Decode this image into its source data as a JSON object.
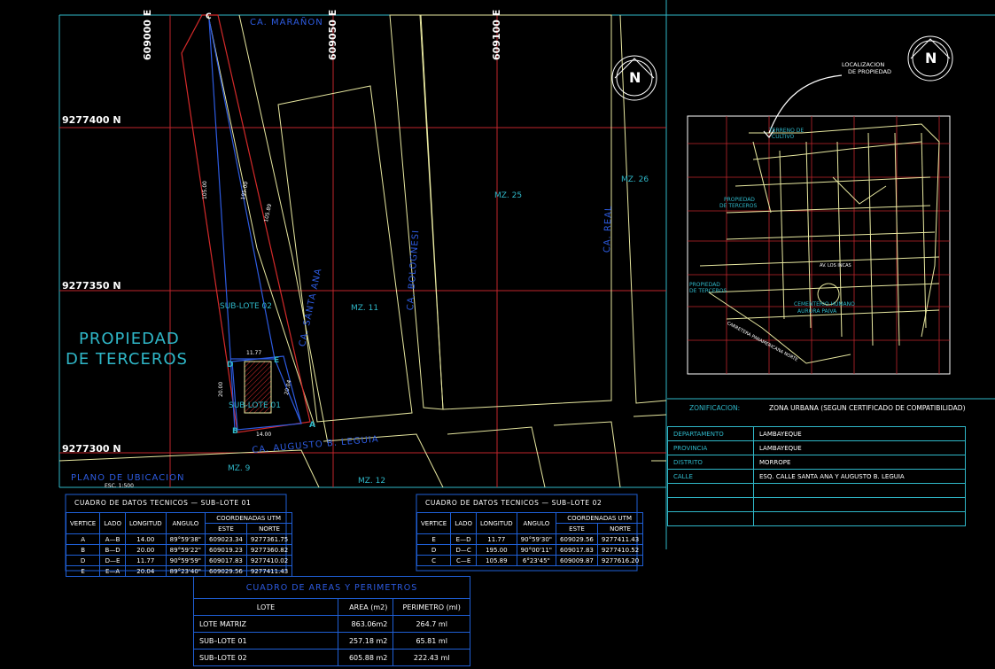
{
  "coords": {
    "e1": "609000 E",
    "e2": "609050 E",
    "e3": "609100 E",
    "n1": "9277400 N",
    "n2": "9277350 N",
    "n3": "9277300 N"
  },
  "streets": {
    "maranon": "CA. MARAÑON",
    "santa_ana": "CA. SANTA ANA",
    "bolognesi": "CA. BOLOGNESI",
    "real": "CA. REAL",
    "leguia": "CA. AUGUSTO B. LEGUIA"
  },
  "blocks": {
    "mz25": "MZ. 25",
    "mz26": "MZ. 26",
    "mz11": "MZ. 11",
    "mz9": "MZ. 9",
    "mz12": "MZ. 12"
  },
  "lots": {
    "sublote02": "SUB-LOTE 02",
    "sublote01": "SUB-LOTE 01",
    "third_party_1": "PROPIEDAD",
    "third_party_2": "DE TERCEROS"
  },
  "vertices": {
    "a": "A",
    "b": "B",
    "c": "C",
    "d": "D",
    "e": "E"
  },
  "dims": {
    "d1": "11.77",
    "d2": "14.00",
    "d3": "20.00",
    "d4": "20.04",
    "d5": "105.00",
    "d6": "195.00",
    "d7": "105.89"
  },
  "plan_title": "PLANO DE UBICACION",
  "plan_scale": "ESC. 1:500",
  "north": "N",
  "location_label_1": "LOCALIZACION",
  "location_label_2": "DE PROPIEDAD",
  "inset": {
    "terreno_1": "TERRENO DE",
    "terreno_2": "CULTIVO",
    "prop_1": "PROPIEDAD",
    "prop_2": "DE TERCEROS",
    "prop2_1": "PROPIEDAD",
    "prop2_2": "DE TERCEROS",
    "cementerio_1": "CEMENTERIO HUMANO",
    "cementerio_2": "AURORA PAIVA",
    "av": "AV. LOS INCAS",
    "carretera": "CARRETERA PANAMERICANA NORTE"
  },
  "table1": {
    "title": "CUADRO  DE  DATOS  TECNICOS  —  SUB–LOTE  01",
    "headers": [
      "VERTICE",
      "LADO",
      "LONGITUD",
      "ANGULO"
    ],
    "utm": "COORDENADAS UTM",
    "este": "ESTE",
    "norte": "NORTE",
    "rows": [
      [
        "A",
        "A—B",
        "14.00",
        "89°59'38\"",
        "609023.34",
        "9277361.75"
      ],
      [
        "B",
        "B—D",
        "20.00",
        "89°59'22\"",
        "609019.23",
        "9277360.82"
      ],
      [
        "D",
        "D—E",
        "11.77",
        "90°59'59\"",
        "609017.83",
        "9277410.02"
      ],
      [
        "E",
        "E—A",
        "20.04",
        "89°23'40\"",
        "609029.56",
        "9277411.43"
      ]
    ]
  },
  "table2": {
    "title": "CUADRO  DE  DATOS  TECNICOS  —  SUB–LOTE  02",
    "headers": [
      "VERTICE",
      "LADO",
      "LONGITUD",
      "ANGULO"
    ],
    "utm": "COORDENADAS UTM",
    "este": "ESTE",
    "norte": "NORTE",
    "rows": [
      [
        "E",
        "E—D",
        "11.77",
        "90°59'30\"",
        "609029.56",
        "9277411.43"
      ],
      [
        "D",
        "D—C",
        "195.00",
        "90°00'11\"",
        "609017.83",
        "9277410.52"
      ],
      [
        "C",
        "C—E",
        "105.89",
        "6°23'45\"",
        "609009.87",
        "9277616.20"
      ]
    ]
  },
  "areas": {
    "title": "CUADRO  DE  AREAS  Y  PERIMETROS",
    "h_lote": "LOTE",
    "h_area": "AREA (m2)",
    "h_perim": "PERIMETRO (ml)",
    "rows": [
      [
        "LOTE MATRIZ",
        "863.06m2",
        "264.7  ml"
      ],
      [
        "SUB–LOTE  01",
        "257.18 m2",
        "65.81  ml"
      ],
      [
        "SUB–LOTE  02",
        "605.88 m2",
        "222.43  ml"
      ]
    ]
  },
  "zonificacion": {
    "label": "ZONIFICACION:",
    "value": "ZONA URBANA (SEGUN CERTIFICADO DE COMPATIBILIDAD)"
  },
  "info": [
    [
      "DEPARTAMENTO",
      "LAMBAYEQUE"
    ],
    [
      "PROVINCIA",
      "LAMBAYEQUE"
    ],
    [
      "DISTRITO",
      "MORROPE"
    ],
    [
      "CALLE",
      "ESQ. CALLE SANTA ANA Y AUGUSTO B. LEGUIA"
    ],
    [
      "",
      ""
    ],
    [
      "",
      ""
    ],
    [
      "",
      ""
    ]
  ],
  "colors": {
    "grid": "#c0262c",
    "blocks": "#e8e8a0",
    "frame": "#2fb7c8",
    "blue": "#1f5fd6"
  }
}
